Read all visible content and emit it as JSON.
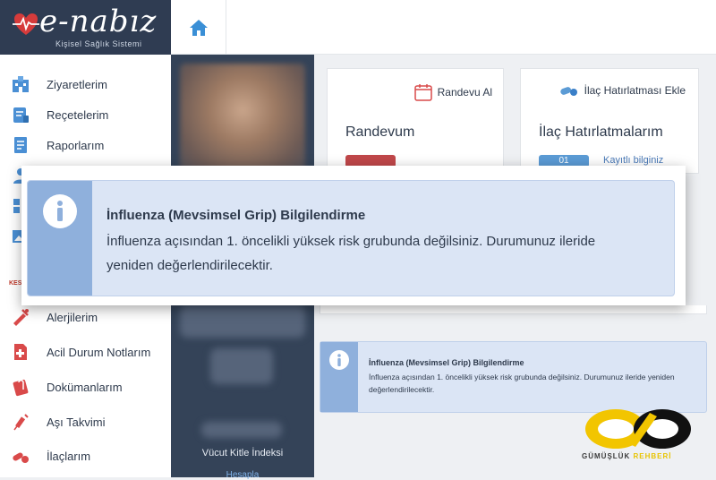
{
  "header": {
    "logo_text": "e-nabız",
    "logo_subtitle": "Kişisel Sağlık Sistemi"
  },
  "sidebar": {
    "items": [
      {
        "label": "Ziyaretlerim",
        "icon": "hospital-icon"
      },
      {
        "label": "Reçetelerim",
        "icon": "prescription-icon"
      },
      {
        "label": "Raporlarım",
        "icon": "report-icon"
      },
      {
        "label": "Alerjilerim",
        "icon": "allergy-icon"
      },
      {
        "label": "Acil Durum Notlarım",
        "icon": "emergency-note-icon"
      },
      {
        "label": "Dokümanlarım",
        "icon": "document-icon"
      },
      {
        "label": "Aşı Takvimi",
        "icon": "vaccine-icon"
      },
      {
        "label": "İlaçlarım",
        "icon": "pills-icon"
      }
    ],
    "kes_label": "KES"
  },
  "profile": {
    "bmi_label": "Vücut Kitle İndeksi",
    "bmi_link": "Hesapla"
  },
  "cards": {
    "randevu": {
      "action_label": "Randevu Al",
      "title": "Randevum"
    },
    "ilac": {
      "action_label": "İlaç Hatırlatması Ekle",
      "title": "İlaç Hatırlatmalarım",
      "count": "01",
      "note": "Kayıtlı bilginiz"
    }
  },
  "alert_small": {
    "title": "İnfluenza (Mevsimsel Grip) Bilgilendirme",
    "body": "İnfluenza açısından 1. öncelikli yüksek risk grubunda değilsiniz. Durumunuz ileride yeniden değerlendirilecektir."
  },
  "alert_big": {
    "title": "İnfluenza (Mevsimsel Grip) Bilgilendirme",
    "body": "İnfluenza açısından 1. öncelikli yüksek risk grubunda değilsiniz. Durumunuz ileride yeniden değerlendirilecektir."
  },
  "watermark": {
    "text_main": "GÜMÜŞLÜK",
    "text_accent": "REHBERİ"
  },
  "colors": {
    "sidebar_dark": "#2f3c52",
    "alert_bg": "#dbe5f5",
    "alert_band": "#8fb0dc",
    "accent_blue": "#3a8fd6"
  }
}
